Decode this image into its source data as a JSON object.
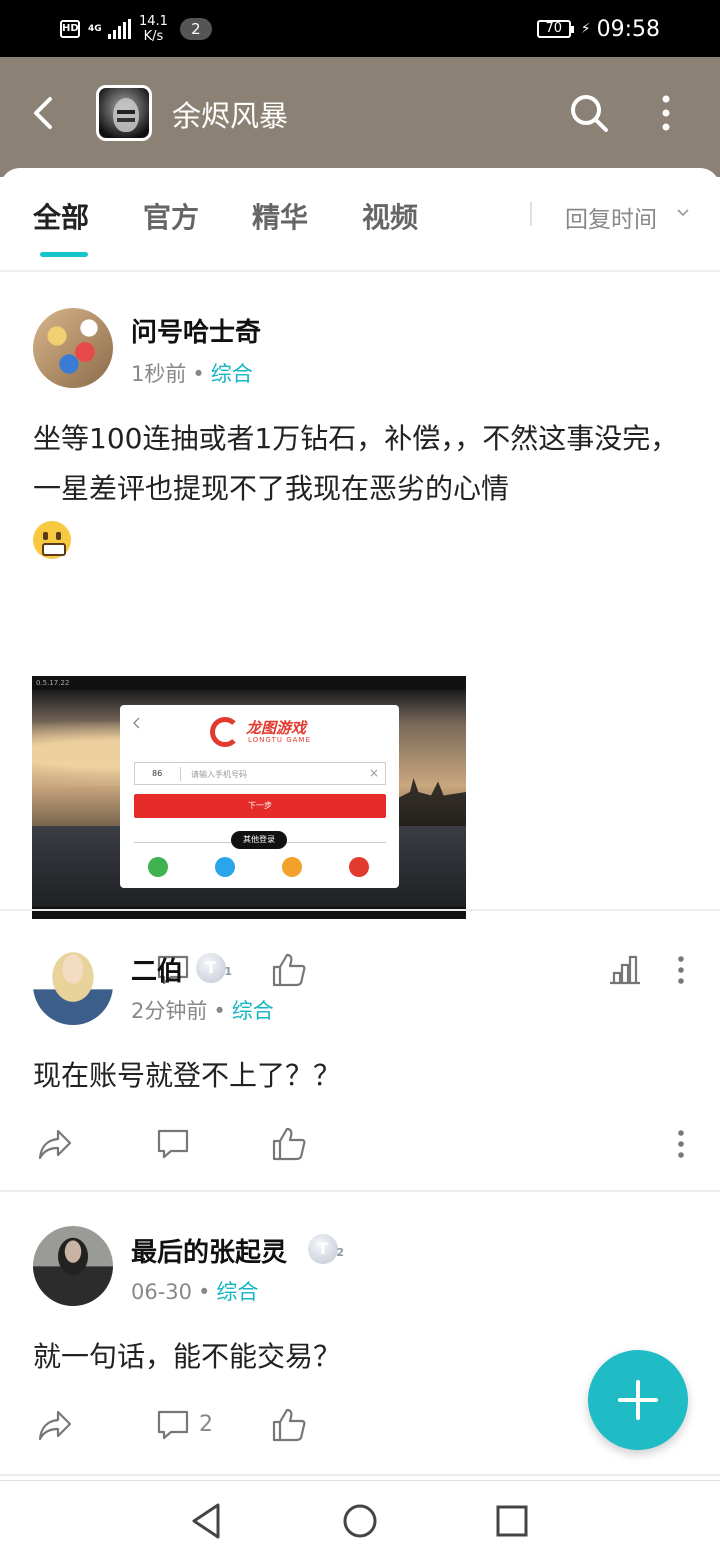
{
  "status_bar": {
    "hd": "HD",
    "network": "4G",
    "speed_value": "14.1",
    "speed_unit": "K/s",
    "notification_count": "2",
    "battery": "70",
    "time": "09:58"
  },
  "header": {
    "title": "余烬风暴",
    "background": "#8b8275"
  },
  "tabs": {
    "items": [
      {
        "label": "全部"
      },
      {
        "label": "官方"
      },
      {
        "label": "精华"
      },
      {
        "label": "视频"
      }
    ],
    "active": "全部",
    "sort_label": "回复时间",
    "accent": "#14c4c9"
  },
  "posts": [
    {
      "username": "问号哈士奇",
      "time": "1秒前",
      "category": "综合",
      "text": "坐等100连抽或者1万钻石，补偿，，不然这事没完，一星差评也提现不了我现在恶劣的心情",
      "emoji": "grimacing-face",
      "image": {
        "version": "0.5.17.22",
        "brand": "龙图游戏",
        "brand_en": "LONGTU GAME",
        "country_code": "86",
        "phone_placeholder": "请输入手机号码",
        "next_button": "下一步",
        "other_login": "其他登录"
      }
    },
    {
      "username": "二伯",
      "badge": "T",
      "badge_level": "1",
      "time": "2分钟前",
      "category": "综合",
      "text": "现在账号就登不上了？？"
    },
    {
      "username": "最后的张起灵",
      "badge": "T",
      "badge_level": "2",
      "time": "06-30",
      "category": "综合",
      "text": "就一句话，能不能交易？",
      "comment_count": "2"
    }
  ],
  "colors": {
    "category": "#14b6c2",
    "fab": "#1fbcc6"
  },
  "fab_icon": "plus-icon"
}
